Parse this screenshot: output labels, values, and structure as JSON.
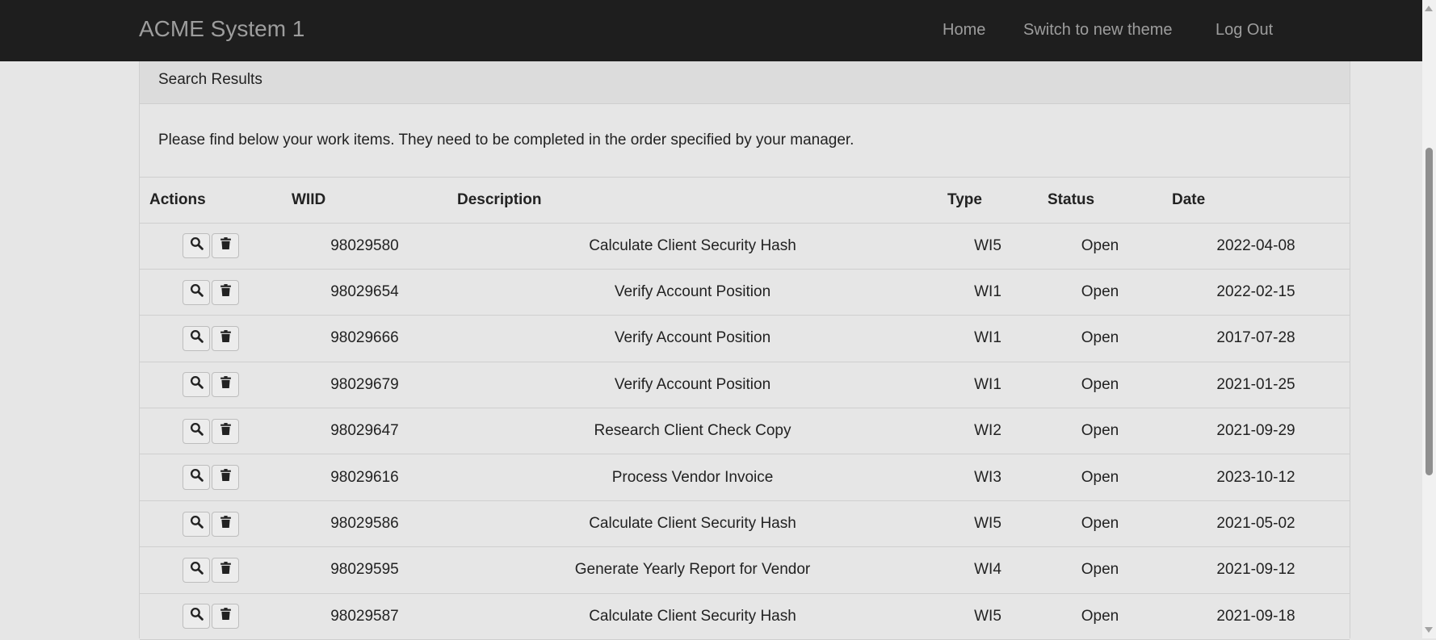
{
  "navbar": {
    "brand": "ACME System 1",
    "links": {
      "home": "Home",
      "switch_theme": "Switch to new theme",
      "logout": "Log Out"
    }
  },
  "panel": {
    "heading": "Search Results",
    "intro": "Please find below your work items. They need to be completed in the order specified by your manager."
  },
  "table": {
    "headers": {
      "actions": "Actions",
      "wiid": "WIID",
      "description": "Description",
      "type": "Type",
      "status": "Status",
      "date": "Date"
    },
    "rows": [
      {
        "wiid": "98029580",
        "description": "Calculate Client Security Hash",
        "type": "WI5",
        "status": "Open",
        "date": "2022-04-08"
      },
      {
        "wiid": "98029654",
        "description": "Verify Account Position",
        "type": "WI1",
        "status": "Open",
        "date": "2022-02-15"
      },
      {
        "wiid": "98029666",
        "description": "Verify Account Position",
        "type": "WI1",
        "status": "Open",
        "date": "2017-07-28"
      },
      {
        "wiid": "98029679",
        "description": "Verify Account Position",
        "type": "WI1",
        "status": "Open",
        "date": "2021-01-25"
      },
      {
        "wiid": "98029647",
        "description": "Research Client Check Copy",
        "type": "WI2",
        "status": "Open",
        "date": "2021-09-29"
      },
      {
        "wiid": "98029616",
        "description": "Process Vendor Invoice",
        "type": "WI3",
        "status": "Open",
        "date": "2023-10-12"
      },
      {
        "wiid": "98029586",
        "description": "Calculate Client Security Hash",
        "type": "WI5",
        "status": "Open",
        "date": "2021-05-02"
      },
      {
        "wiid": "98029595",
        "description": "Generate Yearly Report for Vendor",
        "type": "WI4",
        "status": "Open",
        "date": "2021-09-12"
      },
      {
        "wiid": "98029587",
        "description": "Calculate Client Security Hash",
        "type": "WI5",
        "status": "Open",
        "date": "2021-09-18"
      }
    ]
  },
  "icons": {
    "view": "search-icon",
    "delete": "trash-icon"
  }
}
